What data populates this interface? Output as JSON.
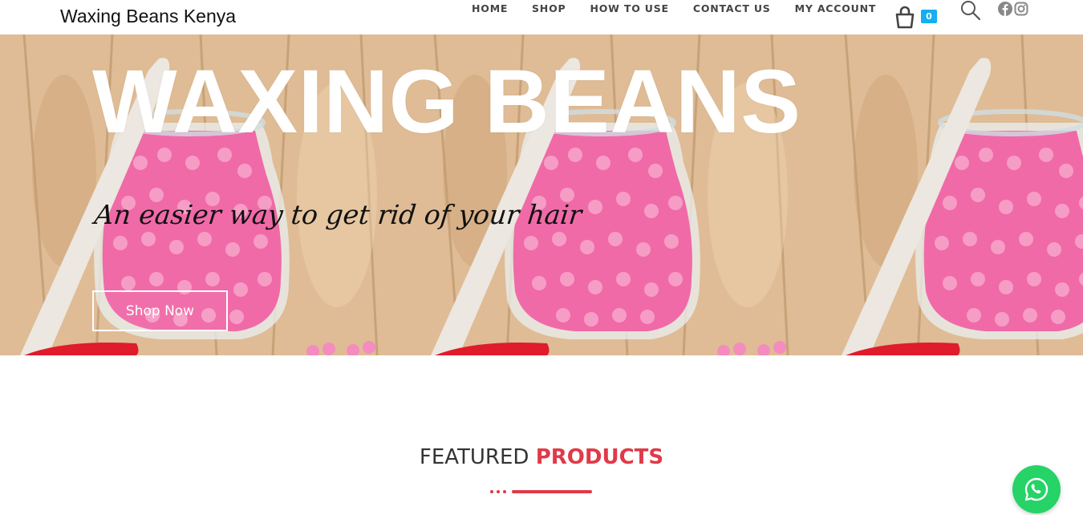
{
  "header": {
    "brand": "Waxing Beans Kenya",
    "nav": [
      "HOME",
      "SHOP",
      "HOW TO USE",
      "CONTACT US",
      "MY ACCOUNT"
    ],
    "cart_count": "0",
    "icons": [
      "shopping-bag-icon",
      "search-icon",
      "facebook-icon",
      "instagram-icon"
    ]
  },
  "hero": {
    "title": "WAXING BEANS",
    "subtitle": "An easier way to get rid of your hair",
    "button": "Shop Now"
  },
  "featured": {
    "word1": "FEATURED",
    "word2": "PRODUCTS"
  },
  "colors": {
    "accent": "#e03a48",
    "cart_badge": "#13aff0",
    "whatsapp": "#25d366",
    "beans": "#f06aa8"
  }
}
